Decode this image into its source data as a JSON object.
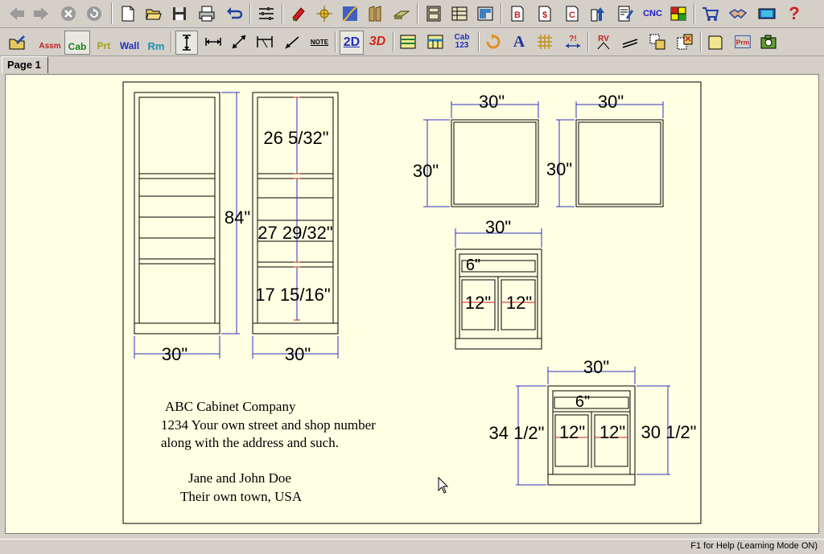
{
  "toolbar_top": [
    {
      "icon": "back-arrow-icon"
    },
    {
      "icon": "forward-arrow-icon"
    },
    {
      "icon": "stop-icon"
    },
    {
      "icon": "refresh-icon"
    },
    {
      "icon": "new-document-icon"
    },
    {
      "icon": "open-folder-icon"
    },
    {
      "icon": "save-disk-icon"
    },
    {
      "icon": "print-icon"
    },
    {
      "icon": "undo-icon"
    },
    {
      "icon": "options-sliders-icon"
    },
    {
      "icon": "materials-icon"
    },
    {
      "icon": "hardware-icon"
    },
    {
      "icon": "door-profile-icon"
    },
    {
      "icon": "molding-icon"
    },
    {
      "icon": "counter-top-icon"
    },
    {
      "icon": "cabinet-list-icon"
    },
    {
      "icon": "parts-list-icon"
    },
    {
      "icon": "room-layout-icon"
    },
    {
      "icon": "bid-report-icon",
      "text": "B"
    },
    {
      "icon": "price-report-icon",
      "text": "$"
    },
    {
      "icon": "cutlist-report-icon",
      "text": "C"
    },
    {
      "icon": "export-icon"
    },
    {
      "icon": "report-edit-icon"
    },
    {
      "icon": "cnc-icon",
      "text": "CNC"
    },
    {
      "icon": "optimizer-icon"
    },
    {
      "icon": "shopping-cart-icon"
    },
    {
      "icon": "handshake-icon"
    },
    {
      "icon": "video-icon"
    },
    {
      "icon": "help-icon",
      "text": "?"
    }
  ],
  "toolbar_bottom": [
    {
      "icon": "edit-mode-icon"
    },
    {
      "icon": "select-assembly-icon",
      "text": "Assm"
    },
    {
      "icon": "select-cabinet-icon",
      "text": "Cab"
    },
    {
      "icon": "select-part-icon",
      "text": "Prt"
    },
    {
      "icon": "select-wall-icon",
      "text": "Wall"
    },
    {
      "icon": "select-room-icon",
      "text": "Rm"
    },
    {
      "icon": "vertical-dimension-icon"
    },
    {
      "icon": "horizontal-dimension-icon"
    },
    {
      "icon": "aligned-dimension-icon"
    },
    {
      "icon": "angle-dimension-icon"
    },
    {
      "icon": "leader-line-icon"
    },
    {
      "icon": "note-icon",
      "text": "NOTE"
    },
    {
      "icon": "view-2d-icon",
      "text": "2D"
    },
    {
      "icon": "view-3d-icon",
      "text": "3D"
    },
    {
      "icon": "elevation-view-icon"
    },
    {
      "icon": "plan-view-icon"
    },
    {
      "icon": "cabinet-numbering-icon",
      "text": "Cab 123"
    },
    {
      "icon": "rotate-icon"
    },
    {
      "icon": "text-icon",
      "text": "A"
    },
    {
      "icon": "grid-icon"
    },
    {
      "icon": "query-dimension-icon",
      "text": "?!"
    },
    {
      "icon": "rv-icon",
      "text": "RV"
    },
    {
      "icon": "level-icon"
    },
    {
      "icon": "copy-icon"
    },
    {
      "icon": "delete-icon"
    },
    {
      "icon": "page-setup-icon"
    },
    {
      "icon": "parameters-icon",
      "text": "Prm"
    },
    {
      "icon": "camera-icon"
    }
  ],
  "tab": {
    "label": "Page 1"
  },
  "status": {
    "text": "F1 for Help (Learning Mode ON)"
  },
  "company": {
    "line1": "ABC Cabinet Company",
    "line2": "1234 Your own street and shop number",
    "line3": "along with the address and such.",
    "line4": "Jane and John Doe",
    "line5": "Their own town, USA"
  },
  "dims": {
    "tall_width": "30\"",
    "tall_height": "84\"",
    "tall2_width": "30\"",
    "tall2_upper": "26 5/32\"",
    "tall2_mid": "27 29/32\"",
    "tall2_lower": "17 15/16\"",
    "wall1_width": "30\"",
    "wall1_height": "30\"",
    "wall2_width": "30\"",
    "wall2_height": "30\"",
    "mid_width": "30\"",
    "mid_drawer": "6\"",
    "mid_door_left": "12\"",
    "mid_door_right": "12\"",
    "base_width": "30\"",
    "base_drawer": "6\"",
    "base_height_left": "34 1/2\"",
    "base_height_right": "30 1/2\"",
    "base_door_left": "12\"",
    "base_door_right": "12\""
  },
  "colors": {
    "paper": "#ffffe3",
    "dim": "#3030c0",
    "accent_red": "#cc2020"
  }
}
